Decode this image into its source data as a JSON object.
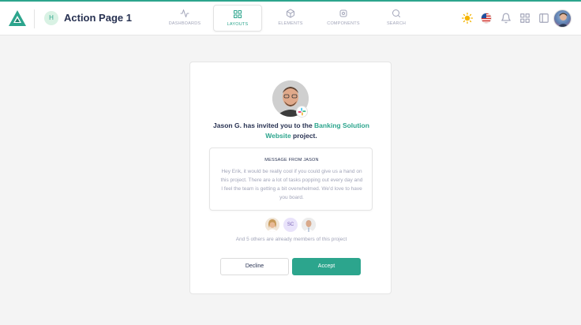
{
  "header": {
    "page_avatar_initial": "H",
    "page_title": "Action Page 1",
    "tabs": [
      {
        "label": "DASHBOARDS",
        "icon": "activity-icon",
        "active": false
      },
      {
        "label": "LAYOUTS",
        "icon": "grid-icon",
        "active": true
      },
      {
        "label": "ELEMENTS",
        "icon": "box-icon",
        "active": false
      },
      {
        "label": "COMPONENTS",
        "icon": "settings-icon",
        "active": false
      },
      {
        "label": "SEARCH",
        "icon": "search-icon",
        "active": false
      }
    ],
    "right_icons": [
      "sun-icon",
      "us-flag-icon",
      "bell-icon",
      "apps-grid-icon",
      "sidebar-icon",
      "user-avatar"
    ]
  },
  "invite": {
    "inviter": "Jason G. has invited you to the ",
    "project": "Banking Solution Website",
    "suffix": " project.",
    "message_title": "MESSAGE FROM JASON",
    "message_body": "Hey Erik, it would be really cool if you could give us a hand on this project. There are a lot of tasks popping out every day and I feel the team is getting a bit overwhelmed. We'd love to have you board.",
    "members": [
      {
        "type": "photo",
        "name": "member-avatar-1"
      },
      {
        "type": "initials",
        "initials": "SC"
      },
      {
        "type": "photo",
        "name": "member-avatar-3"
      }
    ],
    "members_text": "And 5 others are already members of this project",
    "decline_label": "Decline",
    "accept_label": "Accept"
  },
  "colors": {
    "accent": "#2ca58d",
    "text_dark": "#283252",
    "text_muted": "#a2a5b9",
    "background": "#f4f4f4"
  }
}
